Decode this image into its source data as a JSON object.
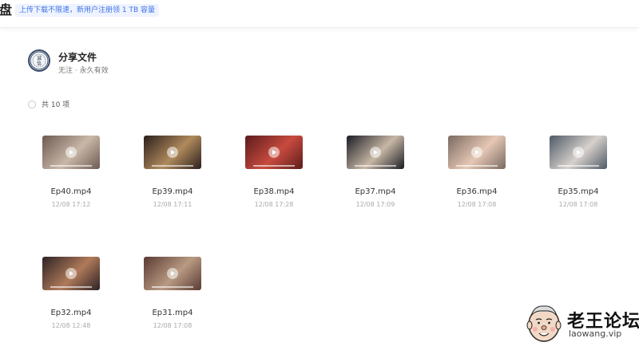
{
  "topbar": {
    "brand_char": "盘",
    "promo": "上传下载不限速，新用户注册领 1 TB 容量"
  },
  "share": {
    "title": "分享文件",
    "subtitle": "无注 · 永久有效",
    "avatar_text": "诚信"
  },
  "selection": {
    "count_label": "共 10 项"
  },
  "files": [
    {
      "name": "Ep40.mp4",
      "date": "12/08 17:12",
      "icon": "video-thumbnail",
      "colors": [
        "#6d5a52",
        "#c9b8a8"
      ]
    },
    {
      "name": "Ep39.mp4",
      "date": "12/08 17:11",
      "icon": "video-thumbnail",
      "colors": [
        "#2a1f1c",
        "#b08a5c"
      ]
    },
    {
      "name": "Ep38.mp4",
      "date": "12/08 17:28",
      "icon": "video-thumbnail",
      "colors": [
        "#5b1c1c",
        "#c84a3e"
      ]
    },
    {
      "name": "Ep37.mp4",
      "date": "12/08 17:09",
      "icon": "video-thumbnail",
      "colors": [
        "#1b1b24",
        "#c7b7a5"
      ]
    },
    {
      "name": "Ep36.mp4",
      "date": "12/08 17:08",
      "icon": "video-thumbnail",
      "colors": [
        "#7a6a60",
        "#e6c7b5"
      ]
    },
    {
      "name": "Ep35.mp4",
      "date": "12/08 17:08",
      "icon": "video-thumbnail",
      "colors": [
        "#4e5a66",
        "#d7d1cc"
      ]
    },
    {
      "name": "Ep32.mp4",
      "date": "12/08 12:48",
      "icon": "video-thumbnail",
      "colors": [
        "#2c2224",
        "#b07a5a"
      ]
    },
    {
      "name": "Ep31.mp4",
      "date": "12/08 17:08",
      "icon": "video-thumbnail",
      "colors": [
        "#5a3a33",
        "#b89a82"
      ]
    }
  ],
  "watermark": {
    "name": "老王论坛",
    "url": "laowang.vip"
  }
}
